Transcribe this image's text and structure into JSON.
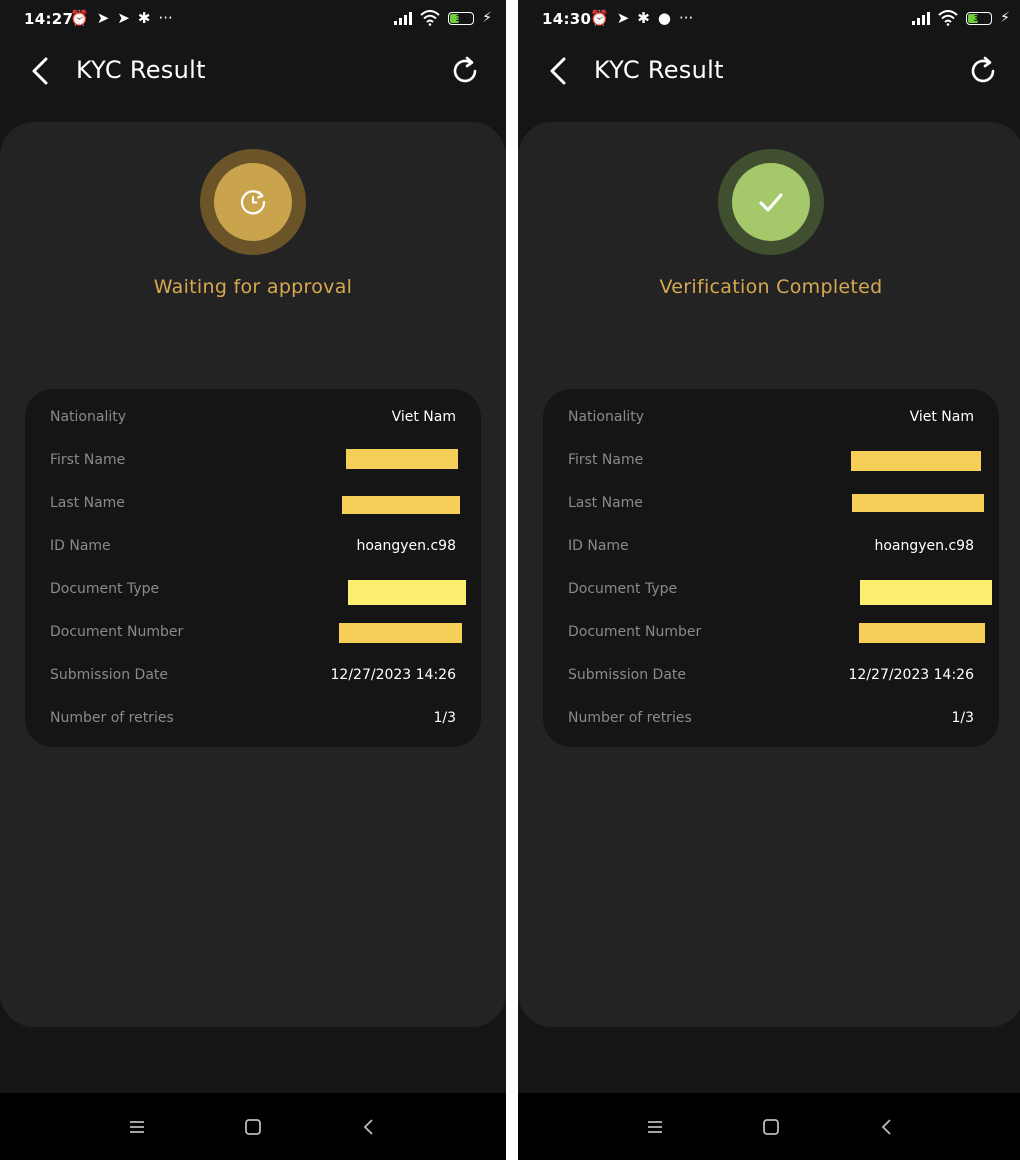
{
  "screens": [
    {
      "status_time": "14:27",
      "status_icons": [
        "alarm-icon",
        "telegram-icon",
        "telegram-icon",
        "slack-icon",
        "more-icon"
      ],
      "battery": "38",
      "battery_level": 0.38,
      "title": "KYC Result",
      "status": {
        "text": "Waiting for approval",
        "icon": "clock-icon",
        "outer_color": "#6a5428",
        "inner_color": "#c9a44c",
        "text_color": "#d6a951"
      },
      "details": [
        {
          "label": "Nationality",
          "value": "Viet Nam"
        },
        {
          "label": "First Name",
          "value": "",
          "redacted": true
        },
        {
          "label": "Last Name",
          "value": "",
          "redacted": true
        },
        {
          "label": "ID Name",
          "value": "hoangyen.c98"
        },
        {
          "label": "Document Type",
          "value": "",
          "redacted": true
        },
        {
          "label": "Document Number",
          "value": "",
          "redacted": true
        },
        {
          "label": "Submission Date",
          "value": "12/27/2023 14:26"
        },
        {
          "label": "Number of retries",
          "value": "1/3"
        }
      ]
    },
    {
      "status_time": "14:30",
      "status_icons": [
        "alarm-icon",
        "telegram-icon",
        "slack-icon",
        "chat-icon",
        "more-icon"
      ],
      "battery": "39",
      "battery_level": 0.39,
      "title": "KYC Result",
      "status": {
        "text": "Verification Completed",
        "icon": "check-icon",
        "outer_color": "#3f4f2f",
        "inner_color": "#a4c86a",
        "text_color": "#d6a951"
      },
      "details": [
        {
          "label": "Nationality",
          "value": "Viet Nam"
        },
        {
          "label": "First Name",
          "value": "",
          "redacted": true
        },
        {
          "label": "Last Name",
          "value": "",
          "redacted": true
        },
        {
          "label": "ID Name",
          "value": "hoangyen.c98"
        },
        {
          "label": "Document Type",
          "value": "",
          "redacted": true
        },
        {
          "label": "Document Number",
          "value": "",
          "redacted": true
        },
        {
          "label": "Submission Date",
          "value": "12/27/2023 14:26"
        },
        {
          "label": "Number of retries",
          "value": "1/3"
        }
      ]
    }
  ],
  "colors": {
    "background": "#151515",
    "card": "#232323",
    "panel": "#151515",
    "label": "#8a8a8a",
    "value": "#ffffff",
    "redaction": "#f5cf57",
    "redaction_bright": "#fcee6e"
  }
}
